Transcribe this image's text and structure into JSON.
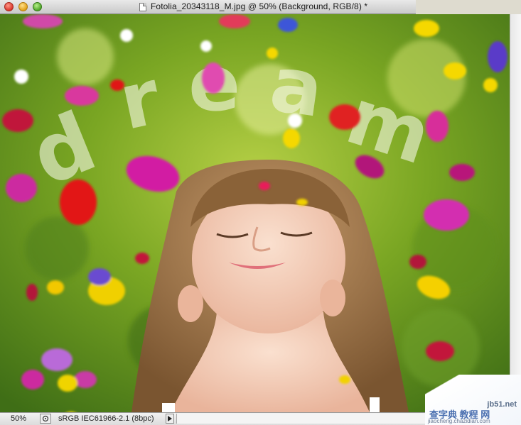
{
  "window": {
    "title": "Fotolia_20343118_M.jpg @ 50% (Background, RGB/8) *"
  },
  "canvas": {
    "overlay_text": "dream"
  },
  "status": {
    "zoom": "50%",
    "profile": "sRGB IEC61966-2.1 (8bpc)"
  },
  "watermark": {
    "site": "jb51.net",
    "chinese": "查字典 教程 网",
    "url": "jiaocheng.chazidian.com"
  },
  "icons": [
    "close-icon",
    "minimize-icon",
    "zoom-icon",
    "document-icon",
    "proof-icon",
    "arrow-right-icon"
  ],
  "colors": {
    "background_green": "#5a8a1a",
    "accent_blue": "#4a6fb0"
  }
}
